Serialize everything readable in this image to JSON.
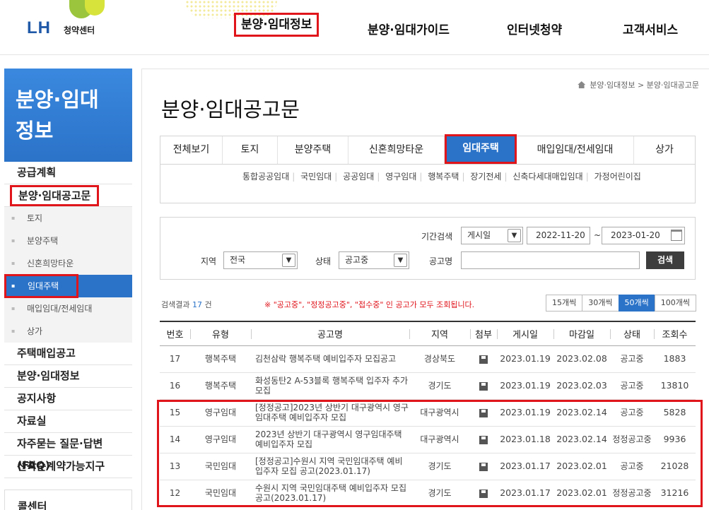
{
  "header": {
    "logo_text": "LH",
    "logo_sub": "청약센터",
    "nav": [
      "분양·임대정보",
      "분양·임대가이드",
      "인터넷청약",
      "고객서비스"
    ]
  },
  "sidebar": {
    "title_line1": "분양·임대",
    "title_line2": "정보",
    "items": [
      "공급계획",
      "분양·임대공고문"
    ],
    "subitems": [
      "토지",
      "분양주택",
      "신혼희망타운",
      "임대주택",
      "매입임대/전세임대",
      "상가"
    ],
    "items2": [
      "주택매입공고",
      "분양·임대정보",
      "공지사항",
      "자료실",
      "자주묻는 질문·답변(FAQ)",
      "선착순계약가능지구"
    ],
    "callcenter": "콜센터"
  },
  "breadcrumb": {
    "level1": "분양·임대정보",
    "level2": "분양·임대공고문"
  },
  "page_title": "분양·임대공고문",
  "tabs": [
    "전체보기",
    "토지",
    "분양주택",
    "신혼희망타운",
    "임대주택",
    "매입임대/전세임대",
    "상가"
  ],
  "subtabs": [
    "통합공공임대",
    "국민임대",
    "공공임대",
    "영구임대",
    "행복주택",
    "장기전세",
    "신축다세대매입임대",
    "가정어린이집"
  ],
  "search": {
    "period_label": "기간검색",
    "period_type": "게시일",
    "date_from": "2022-11-20",
    "date_sep": "~",
    "date_to": "2023-01-20",
    "region_label": "지역",
    "region_value": "전국",
    "status_label": "상태",
    "status_value": "공고중",
    "name_label": "공고명",
    "name_value": "",
    "button": "검색"
  },
  "result": {
    "prefix": "검색결과",
    "count": "17",
    "suffix": "건"
  },
  "notice": "※ \"공고중\", \"정정공고중\", \"접수중\" 인 공고가 모두 조회됩니다.",
  "page_size": [
    "15개씩",
    "30개씩",
    "50개씩",
    "100개씩"
  ],
  "table": {
    "headers": [
      "번호",
      "유형",
      "공고명",
      "지역",
      "첨부",
      "게시일",
      "마감일",
      "상태",
      "조회수"
    ],
    "rows": [
      {
        "no": "17",
        "type": "행복주택",
        "title": "김천삼락 행복주택 예비입주자 모집공고",
        "region": "경상북도",
        "post": "2023.01.19",
        "due": "2023.02.08",
        "status": "공고중",
        "views": "1883"
      },
      {
        "no": "16",
        "type": "행복주택",
        "title": "화성동탄2 A-53블록 행복주택 입주자 추가모집",
        "region": "경기도",
        "post": "2023.01.19",
        "due": "2023.02.03",
        "status": "공고중",
        "views": "13810"
      },
      {
        "no": "15",
        "type": "영구임대",
        "title": "[정정공고]2023년 상반기 대구광역시 영구임대주택 예비입주자 모집",
        "region": "대구광역시",
        "post": "2023.01.19",
        "due": "2023.02.14",
        "status": "공고중",
        "views": "5828"
      },
      {
        "no": "14",
        "type": "영구임대",
        "title": "2023년 상반기 대구광역시 영구임대주택 예비입주자 모집",
        "region": "대구광역시",
        "post": "2023.01.18",
        "due": "2023.02.14",
        "status": "정정공고중",
        "views": "9936"
      },
      {
        "no": "13",
        "type": "국민임대",
        "title": "[정정공고]수원시 지역 국민임대주택 예비입주자 모집 공고(2023.01.17)",
        "region": "경기도",
        "post": "2023.01.17",
        "due": "2023.02.01",
        "status": "공고중",
        "views": "21028"
      },
      {
        "no": "12",
        "type": "국민임대",
        "title": "수원시 지역 국민임대주택 예비입주자 모집 공고(2023.01.17)",
        "region": "경기도",
        "post": "2023.01.17",
        "due": "2023.02.01",
        "status": "정정공고중",
        "views": "31216"
      }
    ]
  },
  "colors": {
    "accent": "#2b73c9",
    "highlight": "#e0151c",
    "logo_blue": "#1f59a7",
    "logo_green": "#9bc53d"
  }
}
